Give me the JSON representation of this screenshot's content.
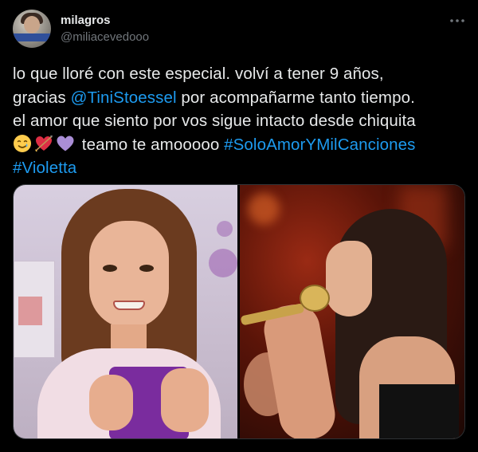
{
  "user": {
    "display_name": "milagros",
    "handle": "@miliacevedooo"
  },
  "more_button": {
    "icon": "more-horizontal-icon"
  },
  "tweet": {
    "line1": "lo que lloré con este especial. volví a tener 9 años,",
    "line2_prefix": "gracias ",
    "mention": "@TiniStoessel",
    "line2_suffix": " por acompañarme tanto tiempo.",
    "line3": "el amor que siento por vos sigue intacto desde chiquita",
    "emojis": [
      "smiling-face-with-tear-icon",
      "heart-with-arrow-icon",
      "purple-heart-icon"
    ],
    "line4_text": " teamo te amooooo ",
    "hashtag1": "#SoloAmorYMilCanciones",
    "hashtag2": "#Violetta"
  },
  "media": {
    "photos": [
      {
        "name": "photo-violetta-character"
      },
      {
        "name": "photo-tini-singing"
      }
    ]
  },
  "colors": {
    "background": "#000000",
    "text": "#e7e9ea",
    "secondary_text": "#71767b",
    "link": "#1d9bf0",
    "border": "#2f3336"
  }
}
